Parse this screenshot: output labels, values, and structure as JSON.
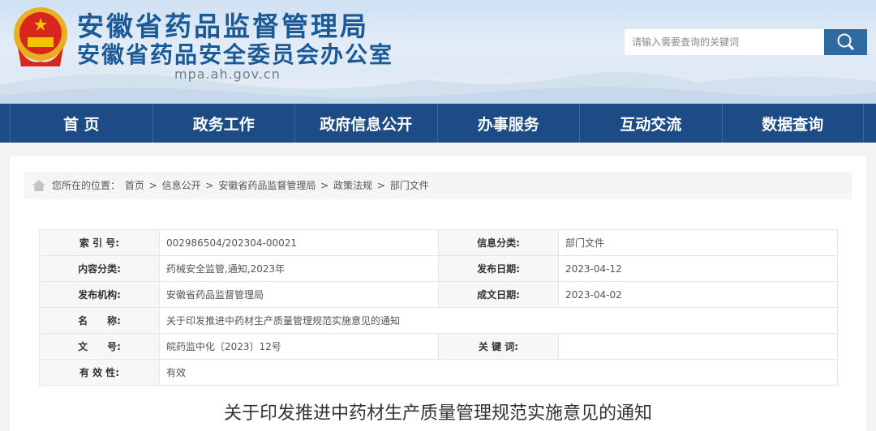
{
  "header": {
    "title_main": "安徽省药品监督管理局",
    "title_sub": "安徽省药品安全委员会办公室",
    "url": "mpa.ah.gov.cn",
    "search_placeholder": "请输入需要查询的关键词"
  },
  "nav": [
    "首 页",
    "政务工作",
    "政府信息公开",
    "办事服务",
    "互动交流",
    "数据查询"
  ],
  "breadcrumb": {
    "prefix": "您所在的位置：",
    "items": [
      "首页",
      "信息公开",
      "安徽省药品监督管理局",
      "政策法规",
      "部门文件"
    ],
    "sep": ">"
  },
  "info": {
    "index_label": "索 引 号:",
    "index": "002986504/202304-00021",
    "category_label": "信息分类:",
    "category": "部门文件",
    "content_label": "内容分类:",
    "content": "药械安全监管,通知,2023年",
    "pubdate_label": "发布日期:",
    "pubdate": "2023-04-12",
    "org_label": "发布机构:",
    "org": "安徽省药品监督管理局",
    "date_label": "成文日期:",
    "date": "2023-04-02",
    "name_label": "名　　称:",
    "name": "关于印发推进中药材生产质量管理规范实施意见的通知",
    "docno_label": "文　　号:",
    "docno": "皖药监中化〔2023〕12号",
    "keyword_label": "关 键 词:",
    "keyword": "",
    "valid_label": "有 效 性:",
    "valid": "有效"
  },
  "article_title": "关于印发推进中药材生产质量管理规范实施意见的通知"
}
